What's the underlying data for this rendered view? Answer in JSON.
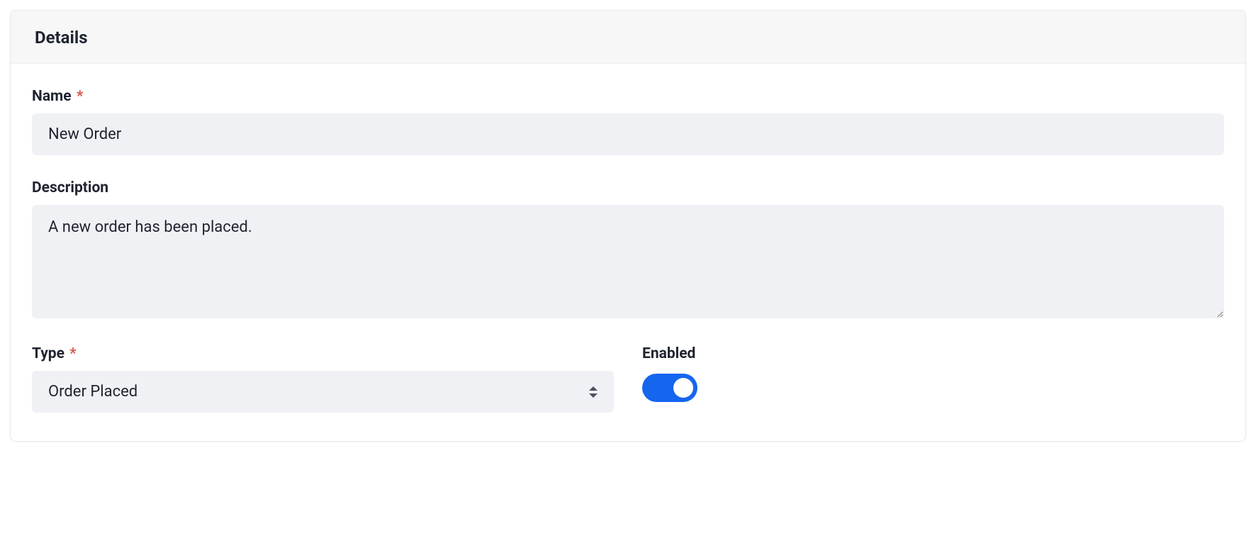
{
  "card": {
    "title": "Details"
  },
  "fields": {
    "name": {
      "label": "Name",
      "required_marker": "*",
      "value": "New Order"
    },
    "description": {
      "label": "Description",
      "value": "A new order has been placed."
    },
    "type": {
      "label": "Type",
      "required_marker": "*",
      "value": "Order Placed"
    },
    "enabled": {
      "label": "Enabled",
      "checked": true
    }
  }
}
